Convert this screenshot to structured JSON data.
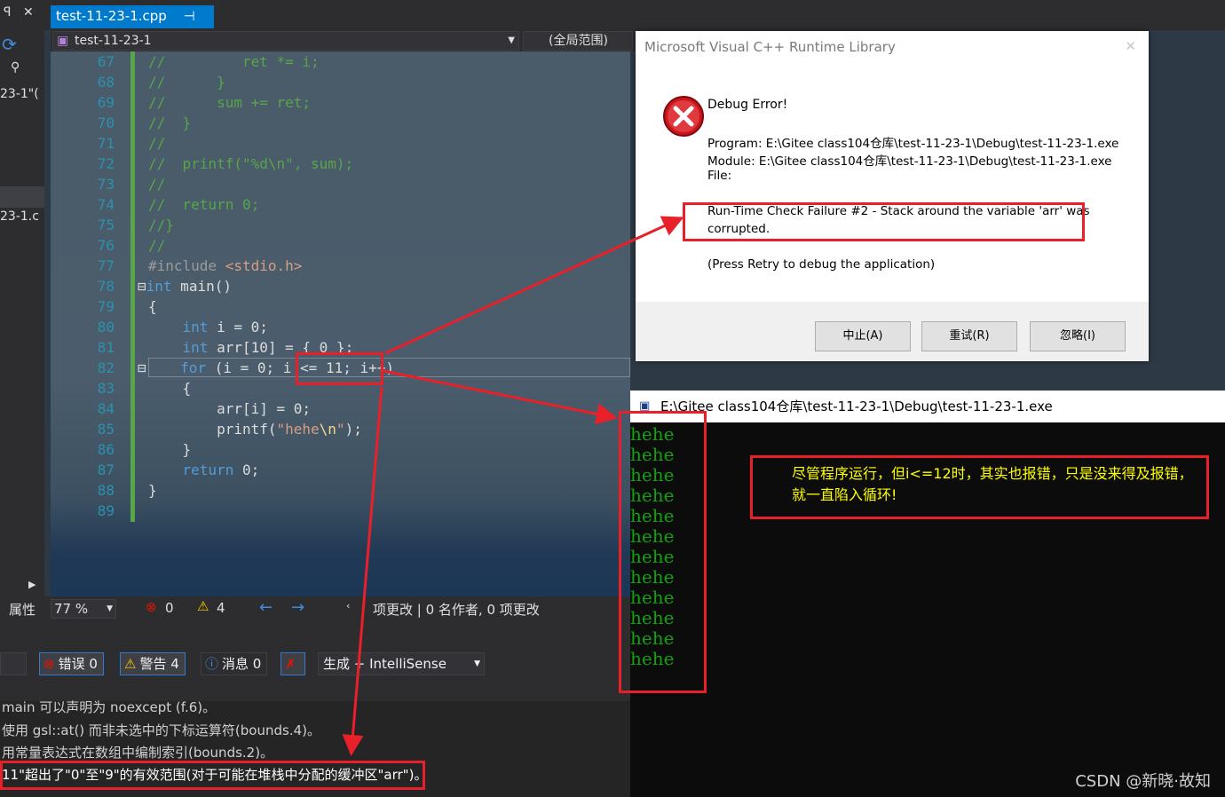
{
  "left_panel": {
    "pin_label": "ꟼ",
    "close_label": "✕",
    "labels": [
      "23-1\"(",
      "23-1.c"
    ],
    "properties_label": "属性"
  },
  "tab": {
    "title": "test-11-23-1.cpp",
    "pin": "⊣",
    "close": "✕"
  },
  "nav": {
    "project": "test-11-23-1",
    "scope": "(全局范围)"
  },
  "editor": {
    "line_numbers": [
      "67",
      "68",
      "69",
      "70",
      "71",
      "72",
      "73",
      "74",
      "75",
      "76",
      "77",
      "78",
      "79",
      "80",
      "81",
      "82",
      "83",
      "84",
      "85",
      "86",
      "87",
      "88",
      "89"
    ]
  },
  "status": {
    "zoom": "77 %",
    "errors": "0",
    "warnings": "4",
    "changes": "项更改 | 0 名作者, 0 项更改"
  },
  "errlist_toolbar": {
    "errors": "错误 0",
    "warnings": "警告 4",
    "messages": "消息 0",
    "build_label": "生成 + IntelliSense"
  },
  "errlist_rows": [
    "main 可以声明为 noexcept (f.6)。",
    "使用 gsl::at() 而非未选中的下标运算符(bounds.4)。",
    "用常量表达式在数组中编制索引(bounds.2)。",
    "11\"超出了\"0\"至\"9\"的有效范围(对于可能在堆栈中分配的缓冲区\"arr\")。"
  ],
  "dialog": {
    "title": "Microsoft Visual C++ Runtime Library",
    "heading": "Debug Error!",
    "program": "Program: E:\\Gitee class104仓库\\test-11-23-1\\Debug\\test-11-23-1.exe",
    "module": "Module: E:\\Gitee class104仓库\\test-11-23-1\\Debug\\test-11-23-1.exe",
    "file": "File:",
    "failure_line1": "Run-Time Check Failure #2 - Stack around the variable 'arr' was",
    "failure_line2": "corrupted.",
    "hint": "(Press Retry to debug the application)",
    "buttons": {
      "abort": "中止(A)",
      "retry": "重试(R)",
      "ignore": "忽略(I)"
    }
  },
  "console": {
    "title": "E:\\Gitee class104仓库\\test-11-23-1\\Debug\\test-11-23-1.exe",
    "output": [
      "hehe",
      "hehe",
      "hehe",
      "hehe",
      "hehe",
      "hehe",
      "hehe",
      "hehe",
      "hehe",
      "hehe",
      "hehe",
      "hehe"
    ]
  },
  "annotation": {
    "line1": "尽管程序运行，但i<=12时，其实也报错，只是没来得及报错，",
    "line2": "就一直陷入循环!"
  },
  "watermark": "CSDN @新晓·故知",
  "colors": {
    "accent": "#007acc",
    "annotation_red": "#e8202a",
    "annotation_text": "#ffff00",
    "console_green": "#13a10e"
  }
}
